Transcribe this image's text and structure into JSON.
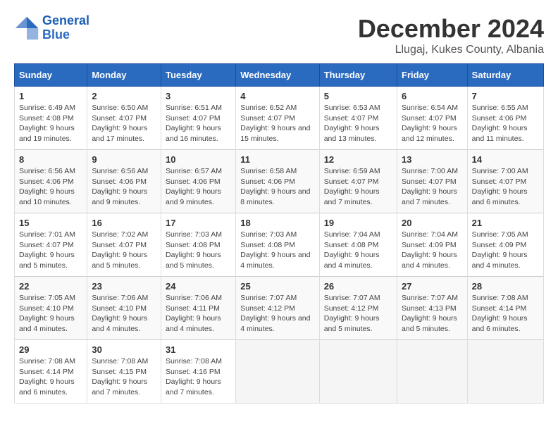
{
  "header": {
    "logo_line1": "General",
    "logo_line2": "Blue",
    "month_year": "December 2024",
    "location": "Llugaj, Kukes County, Albania"
  },
  "weekdays": [
    "Sunday",
    "Monday",
    "Tuesday",
    "Wednesday",
    "Thursday",
    "Friday",
    "Saturday"
  ],
  "weeks": [
    [
      {
        "day": "1",
        "sunrise": "6:49 AM",
        "sunset": "4:08 PM",
        "daylight": "9 hours and 19 minutes."
      },
      {
        "day": "2",
        "sunrise": "6:50 AM",
        "sunset": "4:07 PM",
        "daylight": "9 hours and 17 minutes."
      },
      {
        "day": "3",
        "sunrise": "6:51 AM",
        "sunset": "4:07 PM",
        "daylight": "9 hours and 16 minutes."
      },
      {
        "day": "4",
        "sunrise": "6:52 AM",
        "sunset": "4:07 PM",
        "daylight": "9 hours and 15 minutes."
      },
      {
        "day": "5",
        "sunrise": "6:53 AM",
        "sunset": "4:07 PM",
        "daylight": "9 hours and 13 minutes."
      },
      {
        "day": "6",
        "sunrise": "6:54 AM",
        "sunset": "4:07 PM",
        "daylight": "9 hours and 12 minutes."
      },
      {
        "day": "7",
        "sunrise": "6:55 AM",
        "sunset": "4:06 PM",
        "daylight": "9 hours and 11 minutes."
      }
    ],
    [
      {
        "day": "8",
        "sunrise": "6:56 AM",
        "sunset": "4:06 PM",
        "daylight": "9 hours and 10 minutes."
      },
      {
        "day": "9",
        "sunrise": "6:56 AM",
        "sunset": "4:06 PM",
        "daylight": "9 hours and 9 minutes."
      },
      {
        "day": "10",
        "sunrise": "6:57 AM",
        "sunset": "4:06 PM",
        "daylight": "9 hours and 9 minutes."
      },
      {
        "day": "11",
        "sunrise": "6:58 AM",
        "sunset": "4:06 PM",
        "daylight": "9 hours and 8 minutes."
      },
      {
        "day": "12",
        "sunrise": "6:59 AM",
        "sunset": "4:07 PM",
        "daylight": "9 hours and 7 minutes."
      },
      {
        "day": "13",
        "sunrise": "7:00 AM",
        "sunset": "4:07 PM",
        "daylight": "9 hours and 7 minutes."
      },
      {
        "day": "14",
        "sunrise": "7:00 AM",
        "sunset": "4:07 PM",
        "daylight": "9 hours and 6 minutes."
      }
    ],
    [
      {
        "day": "15",
        "sunrise": "7:01 AM",
        "sunset": "4:07 PM",
        "daylight": "9 hours and 5 minutes."
      },
      {
        "day": "16",
        "sunrise": "7:02 AM",
        "sunset": "4:07 PM",
        "daylight": "9 hours and 5 minutes."
      },
      {
        "day": "17",
        "sunrise": "7:03 AM",
        "sunset": "4:08 PM",
        "daylight": "9 hours and 5 minutes."
      },
      {
        "day": "18",
        "sunrise": "7:03 AM",
        "sunset": "4:08 PM",
        "daylight": "9 hours and 4 minutes."
      },
      {
        "day": "19",
        "sunrise": "7:04 AM",
        "sunset": "4:08 PM",
        "daylight": "9 hours and 4 minutes."
      },
      {
        "day": "20",
        "sunrise": "7:04 AM",
        "sunset": "4:09 PM",
        "daylight": "9 hours and 4 minutes."
      },
      {
        "day": "21",
        "sunrise": "7:05 AM",
        "sunset": "4:09 PM",
        "daylight": "9 hours and 4 minutes."
      }
    ],
    [
      {
        "day": "22",
        "sunrise": "7:05 AM",
        "sunset": "4:10 PM",
        "daylight": "9 hours and 4 minutes."
      },
      {
        "day": "23",
        "sunrise": "7:06 AM",
        "sunset": "4:10 PM",
        "daylight": "9 hours and 4 minutes."
      },
      {
        "day": "24",
        "sunrise": "7:06 AM",
        "sunset": "4:11 PM",
        "daylight": "9 hours and 4 minutes."
      },
      {
        "day": "25",
        "sunrise": "7:07 AM",
        "sunset": "4:12 PM",
        "daylight": "9 hours and 4 minutes."
      },
      {
        "day": "26",
        "sunrise": "7:07 AM",
        "sunset": "4:12 PM",
        "daylight": "9 hours and 5 minutes."
      },
      {
        "day": "27",
        "sunrise": "7:07 AM",
        "sunset": "4:13 PM",
        "daylight": "9 hours and 5 minutes."
      },
      {
        "day": "28",
        "sunrise": "7:08 AM",
        "sunset": "4:14 PM",
        "daylight": "9 hours and 6 minutes."
      }
    ],
    [
      {
        "day": "29",
        "sunrise": "7:08 AM",
        "sunset": "4:14 PM",
        "daylight": "9 hours and 6 minutes."
      },
      {
        "day": "30",
        "sunrise": "7:08 AM",
        "sunset": "4:15 PM",
        "daylight": "9 hours and 7 minutes."
      },
      {
        "day": "31",
        "sunrise": "7:08 AM",
        "sunset": "4:16 PM",
        "daylight": "9 hours and 7 minutes."
      },
      null,
      null,
      null,
      null
    ]
  ]
}
